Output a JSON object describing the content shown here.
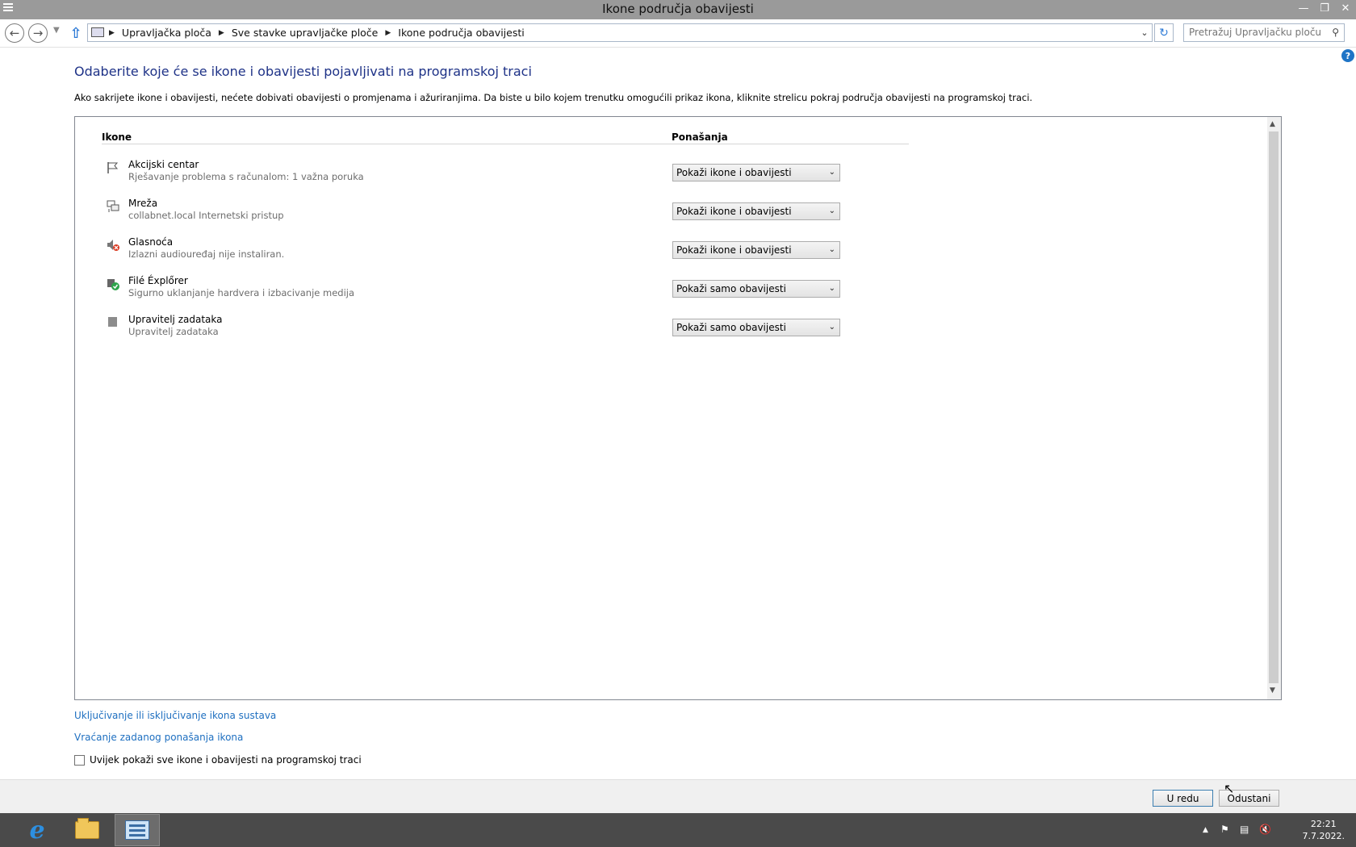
{
  "window": {
    "title": "Ikone područja obavijesti"
  },
  "addressbar": {
    "crumbs": [
      "Upravljačka ploča",
      "Sve stavke upravljačke ploče",
      "Ikone područja obavijesti"
    ],
    "search_placeholder": "Pretražuj Upravljačku ploču"
  },
  "main": {
    "title": "Odaberite koje će se ikone i obavijesti pojavljivati na programskoj traci",
    "description": "Ako sakrijete ikone i obavijesti, nećete dobivati obavijesti o promjenama i ažuriranjima. Da biste u bilo kojem trenutku omogućili prikaz ikona, kliknite strelicu pokraj područja obavijesti na programskoj traci.",
    "columns": {
      "icons": "Ikone",
      "behavior": "Ponašanja"
    },
    "rows": [
      {
        "name": "Akcijski centar",
        "desc": "Rješavanje problema s računalom: 1 važna poruka",
        "behavior": "Pokaži ikone i obavijesti",
        "icon": "flag-icon"
      },
      {
        "name": "Mreža",
        "desc": "collabnet.local Internetski pristup",
        "behavior": "Pokaži ikone i obavijesti",
        "icon": "network-icon"
      },
      {
        "name": "Glasnoća",
        "desc": "Izlazni audiouređaj nije instaliran.",
        "behavior": "Pokaži ikone i obavijesti",
        "icon": "volume-muted-icon"
      },
      {
        "name": "Filé Éxplőrer",
        "desc": "Sigurno uklanjanje hardvera i izbacivanje medija",
        "behavior": "Pokaži samo obavijesti",
        "icon": "safely-remove-icon"
      },
      {
        "name": "Upravitelj zadataka",
        "desc": "Upravitelj zadataka",
        "behavior": "Pokaži samo obavijesti",
        "icon": "task-manager-icon"
      }
    ],
    "link_system_icons": "Uključivanje ili isključivanje ikona sustava",
    "link_restore": "Vraćanje zadanog ponašanja ikona",
    "always_show_label": "Uvijek pokaži sve ikone i obavijesti na programskoj traci",
    "always_show_checked": false
  },
  "buttons": {
    "ok": "U redu",
    "cancel": "Odustani"
  },
  "taskbar": {
    "apps": [
      "internet-explorer",
      "file-explorer",
      "control-panel"
    ],
    "clock_time": "22:21",
    "clock_date": "7.7.2022."
  }
}
